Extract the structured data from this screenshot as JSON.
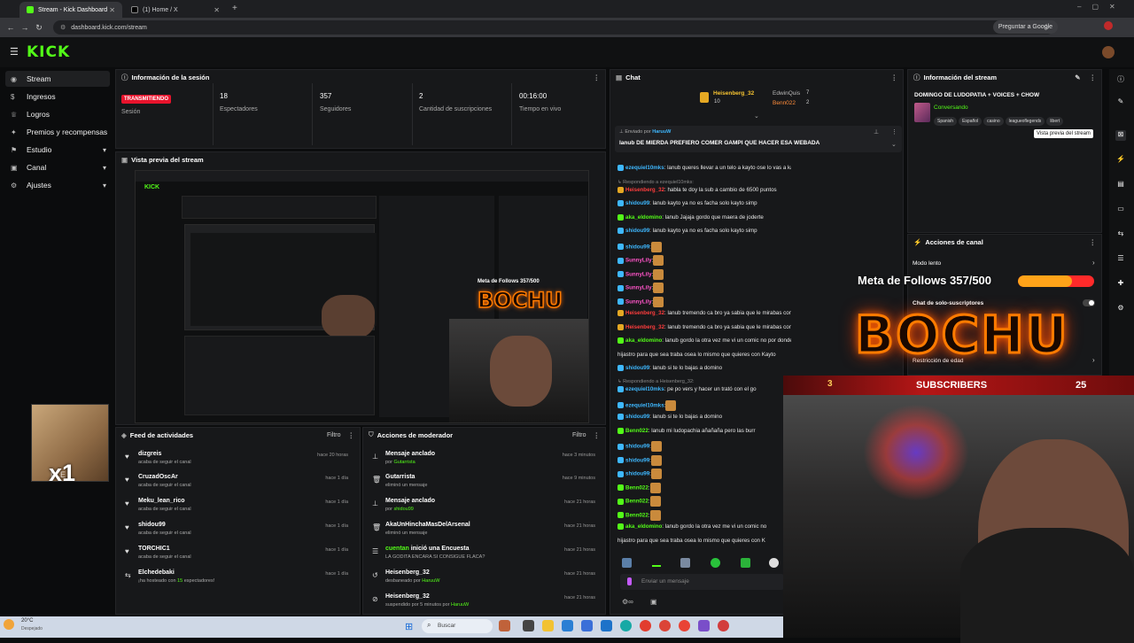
{
  "browser": {
    "tabs": [
      {
        "title": "Stream - Kick Dashboard",
        "active": true
      },
      {
        "title": "(1) Home / X",
        "active": false
      }
    ],
    "url": "dashboard.kick.com/stream",
    "translate_label": "Preguntar a Google"
  },
  "brand": {
    "logo": "KICK",
    "accent": "#53fc18"
  },
  "sidebar": [
    {
      "label": "Stream",
      "icon": "broadcast-icon",
      "active": true
    },
    {
      "label": "Ingresos",
      "icon": "money-icon"
    },
    {
      "label": "Logros",
      "icon": "trophy-icon"
    },
    {
      "label": "Premios y recompensas",
      "icon": "gift-icon"
    },
    {
      "label": "Estudio",
      "icon": "studio-icon",
      "expandable": true
    },
    {
      "label": "Canal",
      "icon": "channel-icon",
      "expandable": true
    },
    {
      "label": "Ajustes",
      "icon": "gear-icon",
      "expandable": true
    }
  ],
  "session": {
    "title": "Información de la sesión",
    "live_badge": "TRANSMITIENDO",
    "session_label": "Sesión",
    "stats": [
      {
        "value": "18",
        "label": "Espectadores"
      },
      {
        "value": "357",
        "label": "Seguidores"
      },
      {
        "value": "2",
        "label": "Cantidad de suscripciones"
      },
      {
        "value": "00:16:00",
        "label": "Tiempo en vivo"
      }
    ]
  },
  "preview": {
    "title": "Vista previa del stream"
  },
  "feed": {
    "title": "Feed de actividades",
    "filter": "Filtro",
    "items": [
      {
        "name": "dizgreis",
        "sub": "acaba de seguir el canal",
        "time": "hace 20 horas",
        "icon": "heart-icon"
      },
      {
        "name": "CruzadOscAr",
        "sub": "acaba de seguir el canal",
        "time": "hace 1 día",
        "icon": "heart-icon"
      },
      {
        "name": "Meku_lean_rico",
        "sub": "acaba de seguir el canal",
        "time": "hace 1 día",
        "icon": "heart-icon"
      },
      {
        "name": "shidou99",
        "sub": "acaba de seguir el canal",
        "time": "hace 1 día",
        "icon": "heart-icon"
      },
      {
        "name": "TORCHIC1",
        "sub": "acaba de seguir el canal",
        "time": "hace 1 día",
        "icon": "heart-icon"
      },
      {
        "name": "Elchedebaki",
        "sub_pre": "¡ha hosteado con ",
        "sub_hl": "15",
        "sub_post": " espectadores!",
        "time": "hace 1 día",
        "icon": "host-icon"
      }
    ]
  },
  "mod": {
    "title": "Acciones de moderador",
    "filter": "Filtro",
    "items": [
      {
        "title": "Mensaje anclado",
        "sub_pre": "por ",
        "sub_user": "Gutarrista",
        "time": "hace 3 minutos",
        "icon": "pin-icon"
      },
      {
        "title": "Gutarrista",
        "sub": "eliminó un mensaje",
        "time": "hace 9 minutos",
        "icon": "trash-icon"
      },
      {
        "title": "Mensaje anclado",
        "sub_pre": "por ",
        "sub_user": "shidou99",
        "time": "hace 21 horas",
        "icon": "pin-icon"
      },
      {
        "title": "AkaUnHinchaMasDelArsenal",
        "sub": "eliminó un mensaje",
        "time": "hace 21 horas",
        "icon": "trash-icon"
      },
      {
        "title_user": "cuentan",
        "title_rest": " inició una Encuesta",
        "sub": "LA GODITA ENCARA SI CONSIGUE FLACA?",
        "time": "hace 21 horas",
        "icon": "poll-icon"
      },
      {
        "title": "Heisenberg_32",
        "sub_pre": "desbaneado por ",
        "sub_user": "HaruuW",
        "time": "hace 21 horas",
        "icon": "unban-icon"
      },
      {
        "title": "Heisenberg_32",
        "sub_pre": "suspendido por 5 minutos por ",
        "sub_user": "HaruuW",
        "time": "hace 21 horas",
        "icon": "ban-icon"
      }
    ]
  },
  "chat": {
    "title": "Chat",
    "leaderboard": [
      {
        "name": "Heisenberg_32",
        "count": "10"
      },
      {
        "name": "EdwinQuis",
        "count": "7"
      },
      {
        "name": "Benn022",
        "count": "2"
      }
    ],
    "pinned_by_label": "Enviado por",
    "pinned_by": "HaruuW",
    "pinned_text": "lanub DE MIERDA PREFIERO COMER GAMPI QUE HACER ESA WEBADA",
    "messages": [
      {
        "user": "ezequiel10mks",
        "color": "u-blue",
        "text": ": lanub queres llevar a un telo a kayto ose lo vas a kachar"
      },
      {
        "reply": "Respondiendo a ezequiel10mks:"
      },
      {
        "user": "Heisenberg_32",
        "color": "u-red",
        "text": ": habla te doy la sub a cambio de 6500 puntos"
      },
      {
        "user": "shidou99",
        "color": "u-blue",
        "text": ": lanub kayto ya no es facha solo kayto simp"
      },
      {
        "user": "aka_eldomino",
        "color": "u-green",
        "text": ": lanub Jajaja gordo que maera de joderte"
      },
      {
        "user": "shidou99",
        "color": "u-blue",
        "text": ": lanub kayto ya no es facha solo kayto simp"
      },
      {
        "user": "shidou99",
        "color": "u-blue",
        "text": ":",
        "emote": true
      },
      {
        "user": "SunnyLily",
        "color": "u-pink",
        "text": ":",
        "emote": true
      },
      {
        "user": "SunnyLily",
        "color": "u-pink",
        "text": ":",
        "emote": true
      },
      {
        "user": "SunnyLily",
        "color": "u-pink",
        "text": ":",
        "emote": true
      },
      {
        "user": "SunnyLily",
        "color": "u-pink",
        "text": ":",
        "emote": true
      },
      {
        "user": "Heisenberg_32",
        "color": "u-red",
        "text": ": lanub tremendo ca bro ya sabia que le mirabas con ganas a"
      },
      {
        "user": "Heisenberg_32",
        "color": "u-red",
        "text": ": lanub tremendo ca bro ya sabia que le mirabas con ganas a"
      },
      {
        "user": "aka_eldomino",
        "color": "u-green",
        "text": ": lanub gordo la otra vez me vi un comic no por donde el padrastro"
      },
      {
        "cont": "hijastro para que sea traba osea lo mismo que quieres con Kayto"
      },
      {
        "user": "shidou99",
        "color": "u-blue",
        "text": ": lanub si te lo bajas a domino"
      },
      {
        "reply": "Respondiendo a Heisenberg_32:"
      },
      {
        "user": "ezequiel10mks",
        "color": "u-blue",
        "text": ": pe po vers y hacer un trató con el go"
      },
      {
        "user": "ezequiel10mks",
        "color": "u-blue",
        "text": ":",
        "emote": true
      },
      {
        "user": "shidou99",
        "color": "u-blue",
        "text": ": lanub si te lo bajas a domino"
      },
      {
        "user": "Benn022",
        "color": "u-green",
        "text": ": lanub mi ludopachia añañaña pero las burr"
      },
      {
        "user": "shidou99",
        "color": "u-blue",
        "text": ":",
        "emote": true
      },
      {
        "user": "shidou99",
        "color": "u-blue",
        "text": ":",
        "emote": true
      },
      {
        "user": "shidou99",
        "color": "u-blue",
        "text": ":",
        "emote": true
      },
      {
        "user": "Benn022",
        "color": "u-green",
        "text": ":",
        "emote": true
      },
      {
        "user": "Benn022",
        "color": "u-green",
        "text": ":",
        "emote": true
      },
      {
        "user": "Benn022",
        "color": "u-green",
        "text": ":",
        "emote": true
      },
      {
        "user": "aka_eldomino",
        "color": "u-green",
        "text": ": lanub gordo la otra vez me vi un comic no"
      },
      {
        "cont": "hijastro para que sea traba osea lo mismo que quieres con K"
      }
    ],
    "input_placeholder": "Enviar un mensaje"
  },
  "stream_info": {
    "title": "Información del stream",
    "stream_title": "DOMINGO DE LUDOPATIA + VOICES + CHOW",
    "category": "Conversando",
    "tags": [
      "Spanish",
      "Español",
      "casino",
      "leagueoflegends",
      "libert"
    ],
    "tooltip": "Vista previa del stream"
  },
  "channel_actions": {
    "title": "Acciones de canal",
    "items": [
      "Modo lento",
      "Chat de solo-suscriptores",
      "Restricción de edad"
    ]
  },
  "overlay": {
    "goal_label": "Meta de Follows 357/500",
    "goal_progress": 0.714,
    "brand_text": "BOCHU",
    "subs_label": "SUBSCRIBERS",
    "subs_left": "3",
    "subs_count": "25",
    "widget_x": "x1",
    "widget_small": "PLE"
  },
  "taskbar": {
    "weather": "20°C",
    "weather_sub": "Despejado",
    "search": "Buscar"
  }
}
